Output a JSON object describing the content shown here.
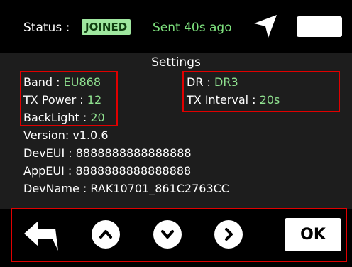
{
  "status_bar": {
    "status_label": "Status :",
    "status_badge": "JOINED",
    "sent_text": "Sent 40s ago",
    "icons": [
      "navigation-arrow-icon",
      "battery-icon"
    ]
  },
  "settings": {
    "title": "Settings",
    "band_label": "Band :",
    "band_value": "EU868",
    "tx_power_label": "TX Power :",
    "tx_power_value": "12",
    "backlight_label": "BackLight :",
    "backlight_value": "20",
    "dr_label": "DR :",
    "dr_value": "DR3",
    "tx_interval_label": "TX Interval :",
    "tx_interval_value": "20s",
    "version_text": "Version: v1.0.6",
    "deveui_text": "DevEUI : 8888888888888888",
    "appeui_text": "AppEUI : 8888888888888888",
    "devname_text": "DevName : RAK10701_861C2763CC"
  },
  "controls": {
    "icons": [
      "back-arrow-icon",
      "chevron-up-icon",
      "chevron-down-icon",
      "chevron-right-icon"
    ],
    "ok_label": "OK"
  },
  "colors": {
    "value_green": "#8fe08f",
    "badge_green": "#9fe79f",
    "highlight_red": "#e00000",
    "background": "#1d1d1d"
  }
}
